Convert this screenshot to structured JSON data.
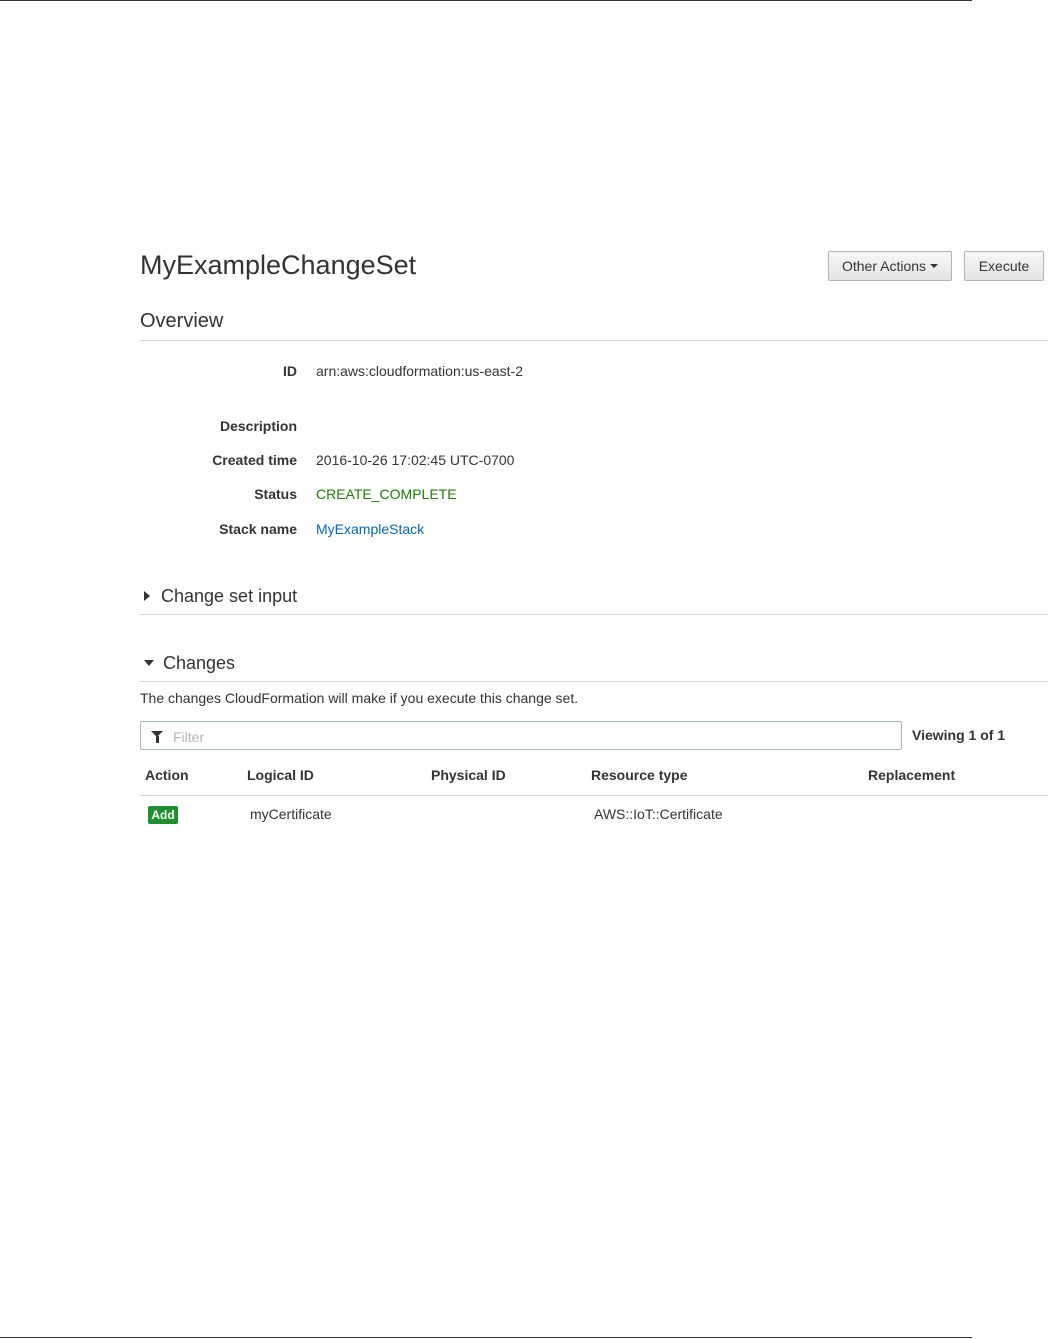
{
  "header": {
    "title": "MyExampleChangeSet",
    "other_actions_label": "Other Actions",
    "execute_label": "Execute"
  },
  "overview": {
    "heading": "Overview",
    "fields": {
      "id_label": "ID",
      "id_value": "arn:aws:cloudformation:us-east-2",
      "id_redacted": "",
      "description_label": "Description",
      "description_value": "",
      "created_label": "Created time",
      "created_value": "2016-10-26 17:02:45 UTC-0700",
      "status_label": "Status",
      "status_value": "CREATE_COMPLETE",
      "stack_label": "Stack name",
      "stack_value": "MyExampleStack"
    }
  },
  "change_set_input": {
    "heading": "Change set input",
    "expanded": false
  },
  "changes": {
    "heading": "Changes",
    "expanded": true,
    "description": "The changes CloudFormation will make if you execute this change set.",
    "filter_placeholder": "Filter",
    "viewing": "Viewing 1 of 1",
    "columns": [
      "Action",
      "Logical ID",
      "Physical ID",
      "Resource type",
      "Replacement"
    ],
    "rows": [
      {
        "action": "Add",
        "logical_id": "myCertificate",
        "physical_id": "",
        "resource_type": "AWS::IoT::Certificate",
        "replacement": ""
      }
    ]
  },
  "colors": {
    "status_complete": "#1d8102",
    "link": "#0066bb",
    "add_badge": "#1d8f2f"
  }
}
